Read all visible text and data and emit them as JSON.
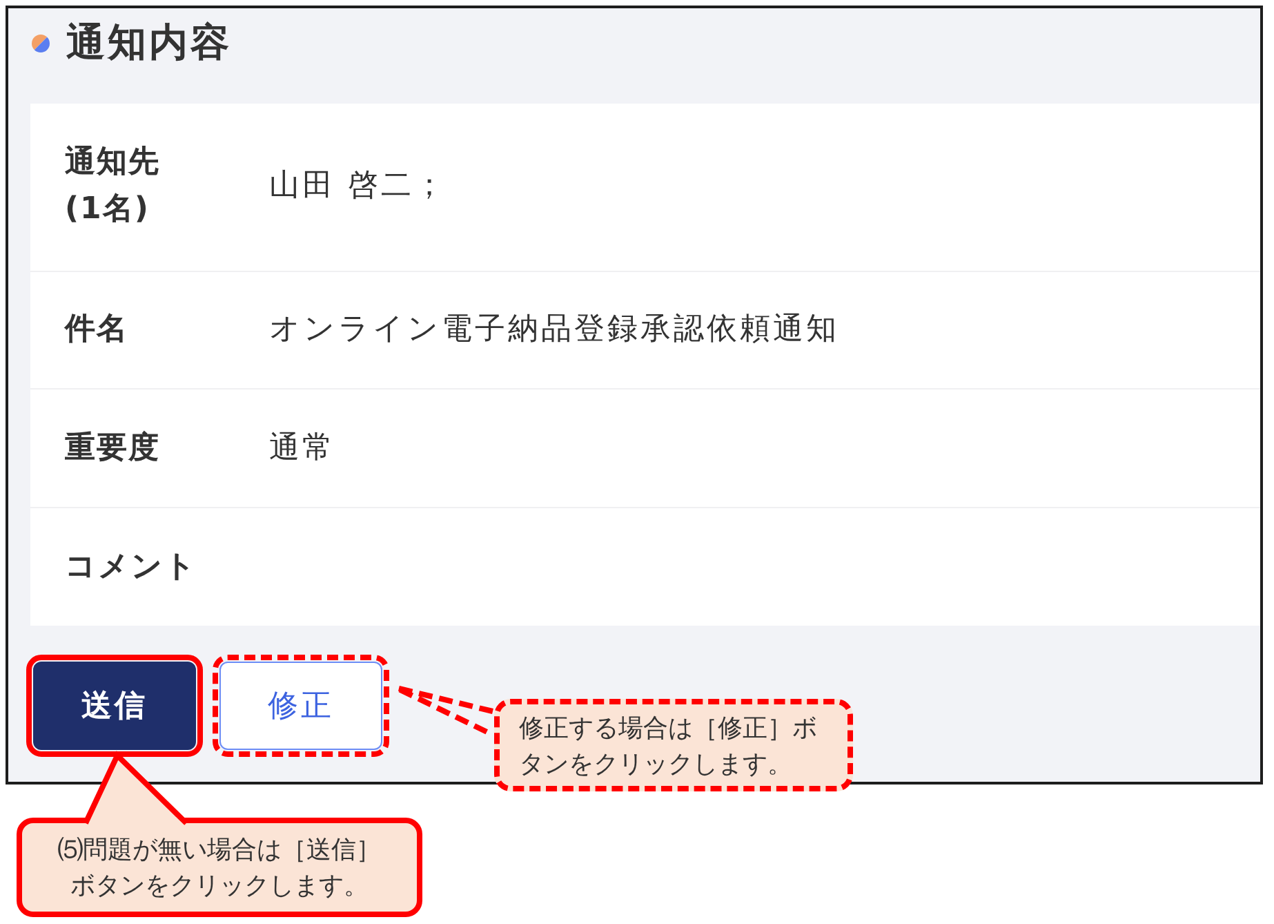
{
  "section": {
    "title": "通知内容"
  },
  "fields": [
    {
      "label": "通知先\n(1名)",
      "value": "山田 啓二；"
    },
    {
      "label": "件名",
      "value": "オンライン電子納品登録承認依頼通知"
    },
    {
      "label": "重要度",
      "value": "通常"
    },
    {
      "label": "コメント"
    }
  ],
  "buttons": [
    {
      "label": "送信",
      "kind": "primary",
      "dashed": false
    },
    {
      "label": "修正",
      "kind": "secondary",
      "dashed": true
    }
  ],
  "callouts": [
    {
      "text": "修正する場合は［修正］ボタンをクリックします。",
      "dashed": true
    },
    {
      "text": "⑸問題が無い場合は［送信］ボタンをクリックします。",
      "dashed": false
    }
  ]
}
